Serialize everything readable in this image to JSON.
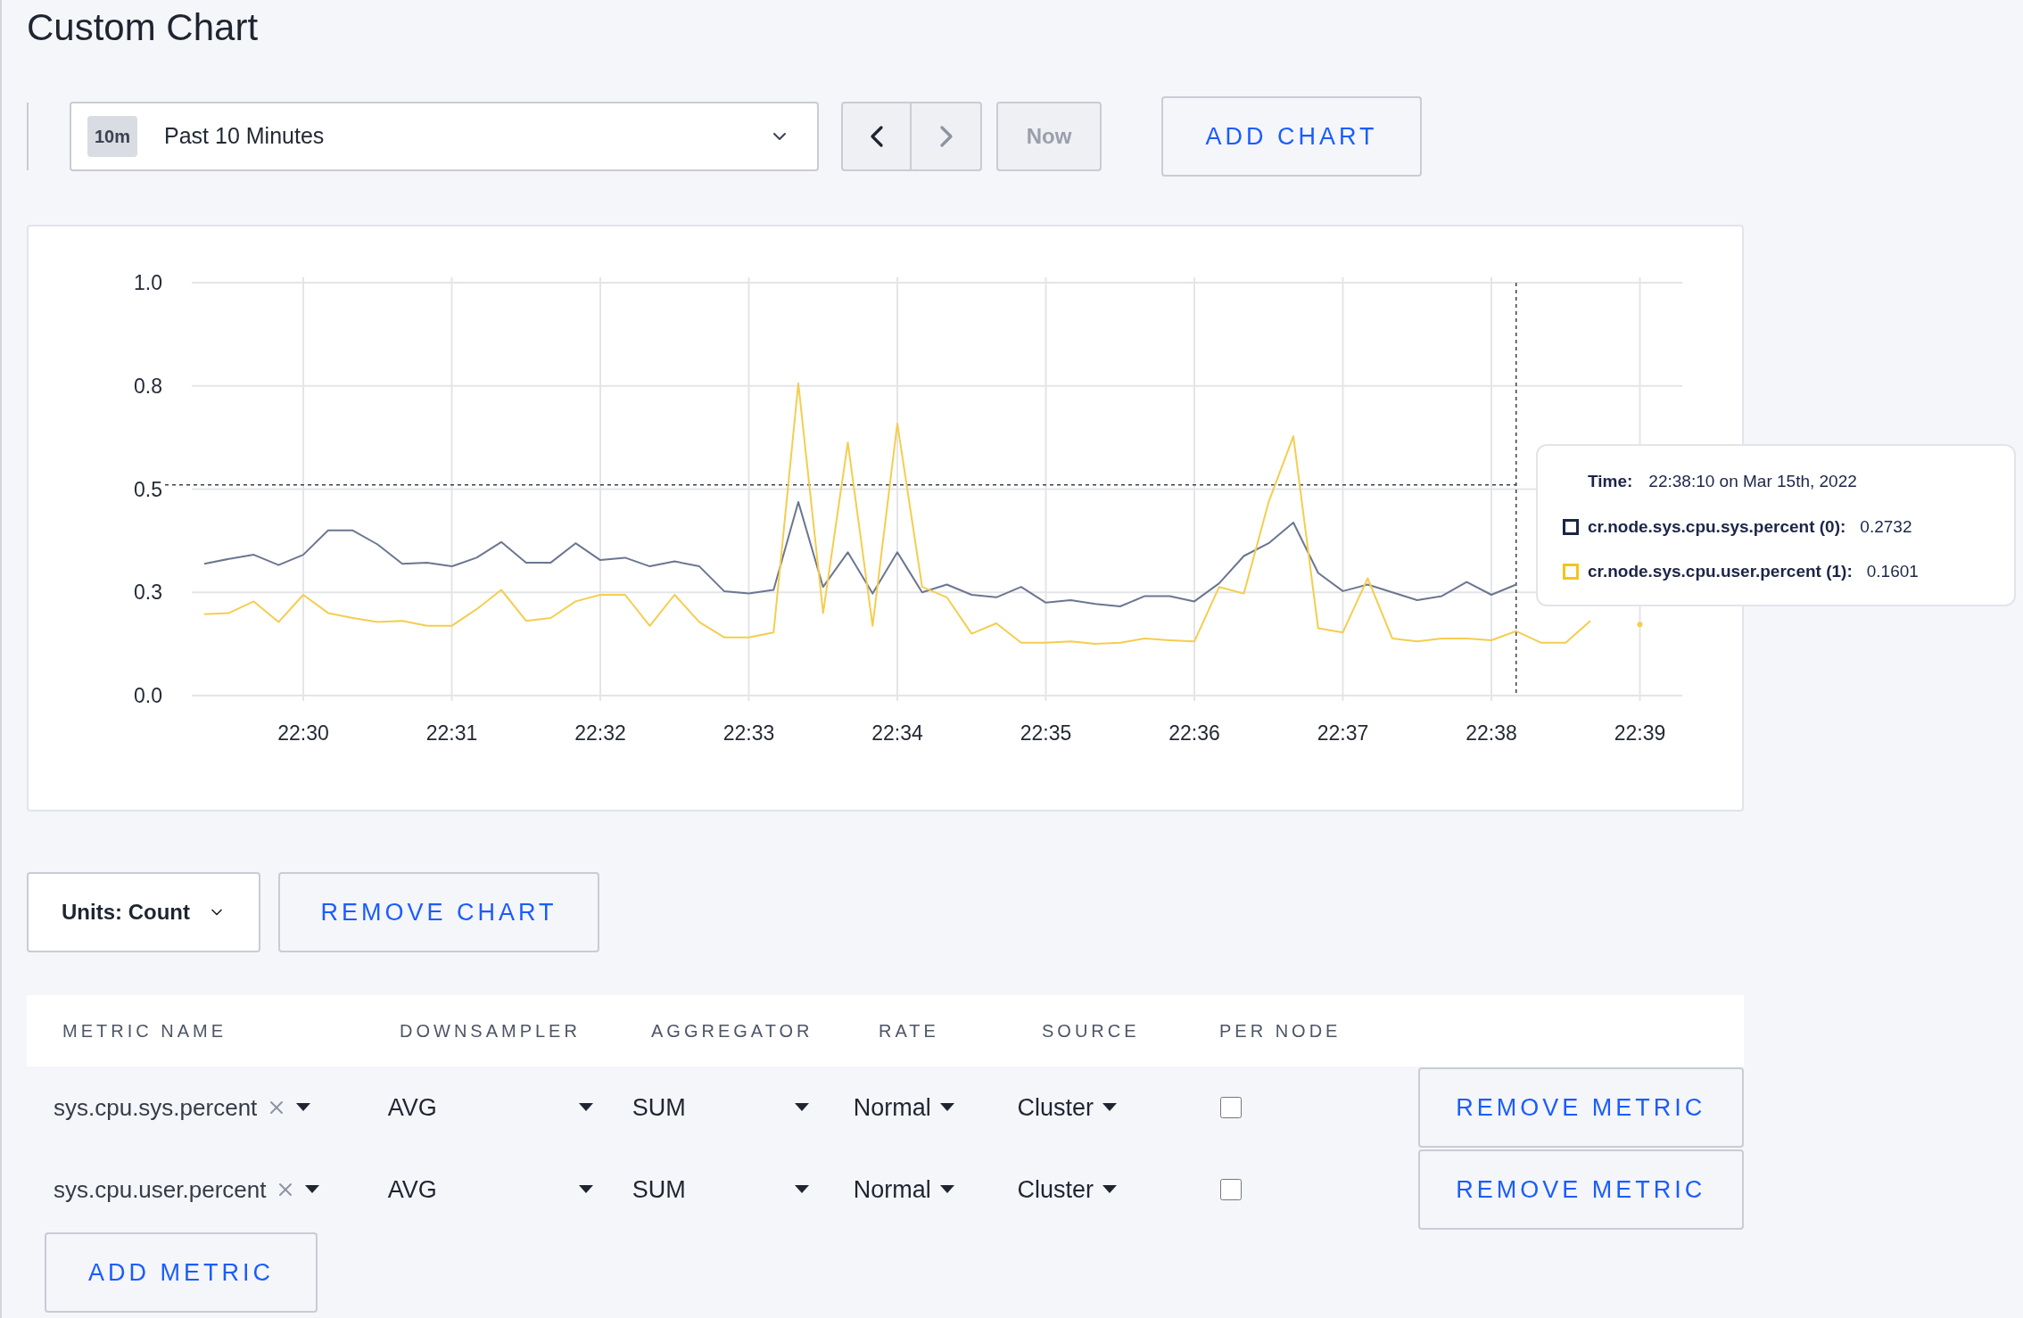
{
  "title": "Custom Chart",
  "time_selector": {
    "badge": "10m",
    "value": "Past 10 Minutes"
  },
  "now_button": {
    "label": "Now",
    "disabled": true
  },
  "add_chart_button": "ADD CHART",
  "chart": {
    "chart_data": {
      "type": "line",
      "categories": [
        null,
        null,
        null,
        null,
        "22:30",
        null,
        null,
        null,
        null,
        null,
        "22:31",
        null,
        null,
        null,
        null,
        null,
        "22:32",
        null,
        null,
        null,
        null,
        null,
        "22:33",
        null,
        null,
        null,
        null,
        null,
        "22:34",
        null,
        null,
        null,
        null,
        null,
        "22:35",
        null,
        null,
        null,
        null,
        null,
        "22:36",
        null,
        null,
        null,
        null,
        null,
        "22:37",
        null,
        null,
        null,
        null,
        null,
        "22:38",
        null,
        null,
        null,
        null,
        null,
        "22:39"
      ],
      "series": [
        {
          "name": "cr.node.sys.cpu.sys.percent (0)",
          "color": "#6b7690",
          "values": [
            0.319,
            0.331,
            0.341,
            0.316,
            0.341,
            0.4,
            0.4,
            0.366,
            0.319,
            0.322,
            0.313,
            0.334,
            0.372,
            0.322,
            0.322,
            0.369,
            0.328,
            0.334,
            0.313,
            0.325,
            0.313,
            0.253,
            0.247,
            0.256,
            0.469,
            0.263,
            0.347,
            0.247,
            0.347,
            0.25,
            0.269,
            0.244,
            0.238,
            0.263,
            0.225,
            0.231,
            0.222,
            0.216,
            0.241,
            0.241,
            0.228,
            0.272,
            0.338,
            0.369,
            0.419,
            0.297,
            0.253,
            0.269,
            0.25,
            0.231,
            0.241,
            0.275,
            0.244,
            0.269,
            null,
            null,
            null,
            null,
            null
          ]
        },
        {
          "name": "cr.node.sys.cpu.user.percent (1)",
          "color": "#f5cd4f",
          "values": [
            0.197,
            0.2,
            0.228,
            0.178,
            0.244,
            0.2,
            0.188,
            0.178,
            0.181,
            0.169,
            0.169,
            0.209,
            0.256,
            0.181,
            0.188,
            0.228,
            0.244,
            0.244,
            0.169,
            0.244,
            0.178,
            0.141,
            0.141,
            0.153,
            0.756,
            0.2,
            0.613,
            0.169,
            0.659,
            0.263,
            0.238,
            0.15,
            0.175,
            0.128,
            0.128,
            0.131,
            0.125,
            0.128,
            0.138,
            0.134,
            0.131,
            0.263,
            0.247,
            0.469,
            0.628,
            0.163,
            0.153,
            0.284,
            0.138,
            0.131,
            0.138,
            0.138,
            0.134,
            0.156,
            0.128,
            0.128,
            0.181,
            null,
            0.172
          ]
        }
      ],
      "ylim": [
        0,
        1
      ],
      "grid": true,
      "yticks": [
        {
          "value": 0,
          "label": "0.0"
        },
        {
          "value": 0.25,
          "label": "0.3"
        },
        {
          "value": 0.5,
          "label": "0.5"
        },
        {
          "value": 0.75,
          "label": "0.8"
        },
        {
          "value": 1,
          "label": "1.0"
        }
      ],
      "ref_lines": [
        {
          "axis": "y",
          "value": 0.51
        }
      ]
    },
    "tooltip": {
      "time_label": "Time:",
      "time_value": "22:38:10 on Mar 15th, 2022",
      "entries": [
        {
          "separator": ":",
          "value": "0.2732",
          "color": "#1b2547"
        },
        {
          "separator": ":",
          "value": "0.1601",
          "color": "#f5c518"
        }
      ]
    }
  },
  "units_dropdown": "Units: Count",
  "remove_chart_button": "REMOVE CHART",
  "metrics_table": {
    "columns": [
      "METRIC NAME",
      "DOWNSAMPLER",
      "AGGREGATOR",
      "RATE",
      "SOURCE",
      "PER NODE"
    ],
    "rows": [
      {
        "metric_name": "sys.cpu.sys.percent",
        "downsampler": "AVG",
        "aggregator": "SUM",
        "rate": "Normal",
        "source": "Cluster",
        "per_node": false,
        "remove_button": "REMOVE METRIC"
      },
      {
        "metric_name": "sys.cpu.user.percent",
        "downsampler": "AVG",
        "aggregator": "SUM",
        "rate": "Normal",
        "source": "Cluster",
        "per_node": false,
        "remove_button": "REMOVE METRIC"
      }
    ]
  },
  "add_metric_button": "ADD METRIC"
}
